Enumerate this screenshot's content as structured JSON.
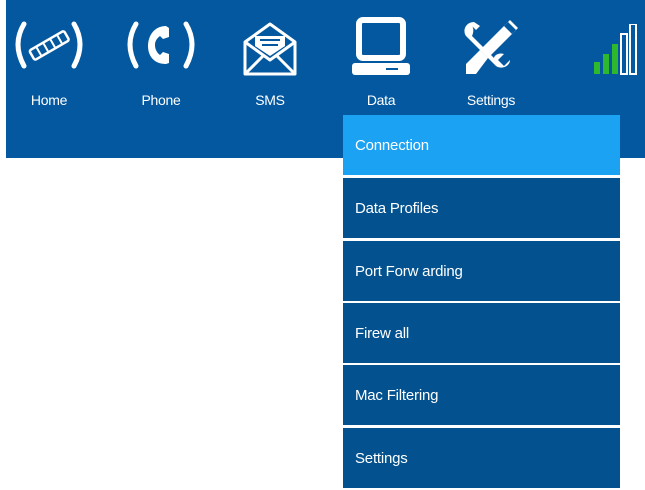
{
  "nav": {
    "items": [
      {
        "label": "Home",
        "icon": "satellite-icon"
      },
      {
        "label": "Phone",
        "icon": "phone-icon"
      },
      {
        "label": "SMS",
        "icon": "envelope-icon"
      },
      {
        "label": "Data",
        "icon": "computer-icon"
      },
      {
        "label": "Settings",
        "icon": "tools-icon"
      }
    ],
    "signal_icon": "signal-bars-icon"
  },
  "data_menu": {
    "items": [
      {
        "label": "Connection",
        "active": true
      },
      {
        "label": "Data Profiles",
        "active": false
      },
      {
        "label": "Port Forw arding",
        "active": false
      },
      {
        "label": "Firew all",
        "active": false
      },
      {
        "label": "Mac Filtering",
        "active": false
      },
      {
        "label": "Settings",
        "active": false
      }
    ]
  },
  "colors": {
    "header_bg": "#03589f",
    "menu_bg": "#03528f",
    "menu_active": "#1ca2f2",
    "signal_green": "#2eb82e"
  }
}
